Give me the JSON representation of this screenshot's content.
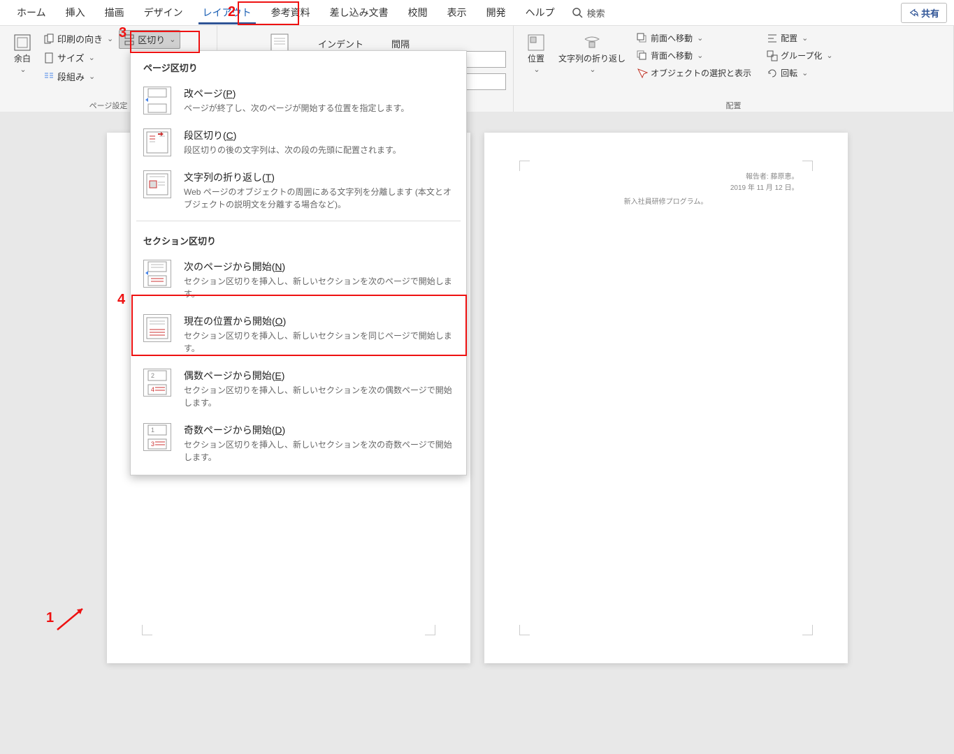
{
  "tabs": [
    "ホーム",
    "挿入",
    "描画",
    "デザイン",
    "レイアウト",
    "参考資料",
    "差し込み文書",
    "校閲",
    "表示",
    "開発",
    "ヘルプ"
  ],
  "active_tab": "レイアウト",
  "search_label": "検索",
  "share_label": "共有",
  "ribbon": {
    "margins": "余白",
    "orientation": "印刷の向き",
    "size": "サイズ",
    "columns": "段組み",
    "breaks": "区切り",
    "page_setup_label": "ページ設定",
    "indent": "インデント",
    "spacing": "間隔",
    "position": "位置",
    "wrap": "文字列の折り返し",
    "bring_forward": "前面へ移動",
    "send_backward": "背面へ移動",
    "selection_pane": "オブジェクトの選択と表示",
    "align": "配置",
    "group": "グループ化",
    "rotate": "回転",
    "arrange_label": "配置"
  },
  "dropdown": {
    "section1_title": "ページ区切り",
    "items1": [
      {
        "title": "改ページ(<u>P</u>)",
        "desc": "ページが終了し、次のページが開始する位置を指定します。"
      },
      {
        "title": "段区切り(<u>C</u>)",
        "desc": "段区切りの後の文字列は、次の段の先頭に配置されます。"
      },
      {
        "title": "文字列の折り返し(<u>T</u>)",
        "desc": "Web ページのオブジェクトの周囲にある文字列を分離します (本文とオブジェクトの説明文を分離する場合など)。"
      }
    ],
    "section2_title": "セクション区切り",
    "items2": [
      {
        "title": "次のページから開始(<u>N</u>)",
        "desc": "セクション区切りを挿入し、新しいセクションを次のページで開始します。"
      },
      {
        "title": "現在の位置から開始(<u>O</u>)",
        "desc": "セクション区切りを挿入し、新しいセクションを同じページで開始します。"
      },
      {
        "title": "偶数ページから開始(<u>E</u>)",
        "desc": "セクション区切りを挿入し、新しいセクションを次の偶数ページで開始します。"
      },
      {
        "title": "奇数ページから開始(<u>D</u>)",
        "desc": "セクション区切りを挿入し、新しいセクションを次の奇数ページで開始します。"
      }
    ]
  },
  "doc": {
    "hdr_line1": "報告者: 藤原恵。",
    "hdr_line2": "2019 年 11 月 12 日。",
    "center_text": "新入社員研修プログラム。"
  },
  "annotations": {
    "n1": "1",
    "n2": "2",
    "n3": "3",
    "n4": "4"
  }
}
